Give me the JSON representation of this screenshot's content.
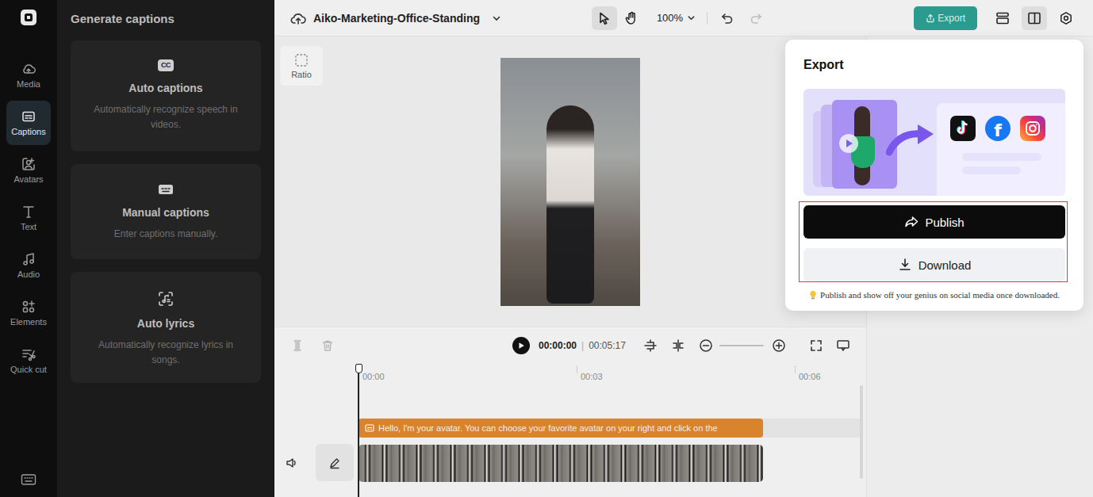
{
  "rail": {
    "items": [
      {
        "label": "Media",
        "kind": "media",
        "selected": false
      },
      {
        "label": "Captions",
        "kind": "captions",
        "selected": true
      },
      {
        "label": "Avatars",
        "kind": "avatars",
        "selected": false
      },
      {
        "label": "Text",
        "kind": "text",
        "selected": false
      },
      {
        "label": "Audio",
        "kind": "audio",
        "selected": false
      },
      {
        "label": "Elements",
        "kind": "elements",
        "selected": false
      },
      {
        "label": "Quick cut",
        "kind": "quickcut",
        "selected": false
      }
    ]
  },
  "panel": {
    "title": "Generate captions",
    "cards": [
      {
        "kind": "auto",
        "icon_text": "CC",
        "title": "Auto captions",
        "description": "Automatically recognize speech in videos."
      },
      {
        "kind": "manual",
        "icon_text": "",
        "title": "Manual captions",
        "description": "Enter captions manually."
      },
      {
        "kind": "lyrics",
        "icon_text": "",
        "title": "Auto lyrics",
        "description": "Automatically recognize lyrics in songs."
      }
    ]
  },
  "topbar": {
    "project": "Aiko-Marketing-Office-Standing",
    "tools": [
      {
        "kind": "pointer",
        "selected": true
      },
      {
        "kind": "hand",
        "selected": false
      }
    ],
    "zoom": "100%",
    "history": [
      {
        "kind": "undo",
        "disabled": false
      },
      {
        "kind": "redo",
        "disabled": true
      }
    ],
    "export": "Export",
    "right_tools": [
      {
        "kind": "layers",
        "selected": false
      },
      {
        "kind": "panel",
        "selected": true
      },
      {
        "kind": "settings",
        "selected": false
      }
    ]
  },
  "canvas": {
    "ratio": "Ratio"
  },
  "timeline": {
    "current": "00:00:00",
    "separator": "|",
    "total": "00:05:17",
    "ruler": [
      "00:00",
      "00:03",
      "00:06"
    ],
    "caption": "Hello, I'm your avatar. You can choose your favorite avatar on your right and click on the"
  },
  "export_dialog": {
    "title": "Export",
    "social": [
      {
        "kind": "tiktok",
        "glyph": ""
      },
      {
        "kind": "facebook",
        "glyph": "f"
      },
      {
        "kind": "instagram",
        "glyph": ""
      }
    ],
    "actions": [
      {
        "label": "Publish",
        "kind": "primary"
      },
      {
        "label": "Download",
        "kind": "secondary"
      }
    ],
    "tip": "Publish and show off your genius on social media once downloaded."
  }
}
